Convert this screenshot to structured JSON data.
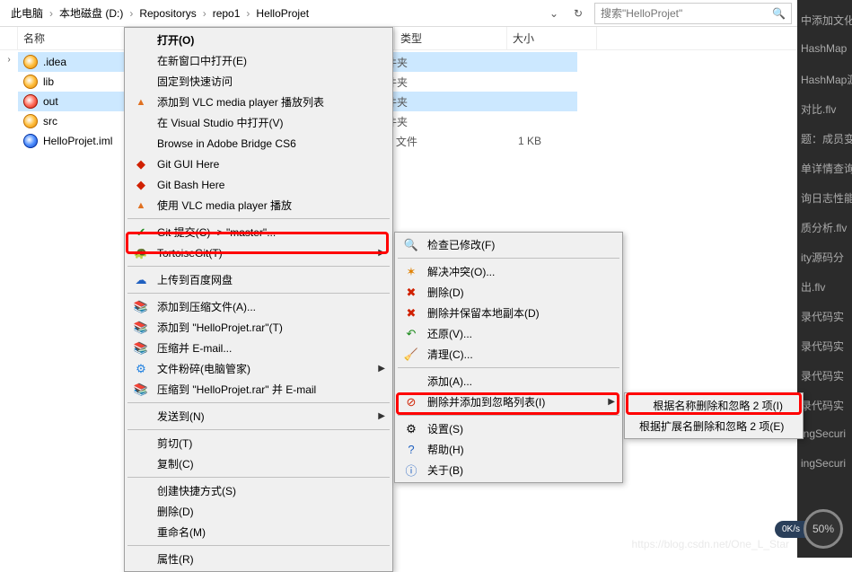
{
  "breadcrumb": {
    "items": [
      "此电脑",
      "本地磁盘 (D:)",
      "Repositorys",
      "repo1",
      "HelloProjet"
    ],
    "refresh": "↻"
  },
  "search": {
    "placeholder": "搜索\"HelloProjet\""
  },
  "columns": {
    "name": "名称",
    "type": "类型",
    "size": "大小"
  },
  "files": [
    {
      "name": ".idea",
      "type": "文件夹",
      "size": "",
      "icon": "y",
      "sel": true
    },
    {
      "name": "lib",
      "type": "文件夹",
      "size": "",
      "icon": "y",
      "sel": false
    },
    {
      "name": "out",
      "type": "文件夹",
      "size": "",
      "icon": "r",
      "sel": true
    },
    {
      "name": "src",
      "type": "文件夹",
      "size": "",
      "icon": "y",
      "sel": false
    },
    {
      "name": "HelloProjet.iml",
      "type": "IML 文件",
      "size": "1 KB",
      "icon": "b",
      "sel": false
    }
  ],
  "ctx1": [
    {
      "t": "打开(O)",
      "icon": "",
      "bold": true
    },
    {
      "t": "在新窗口中打开(E)",
      "icon": ""
    },
    {
      "t": "固定到快速访问",
      "icon": ""
    },
    {
      "t": "添加到 VLC media player 播放列表",
      "icon": "▲",
      "cls": "vlc"
    },
    {
      "t": "在 Visual Studio 中打开(V)",
      "icon": ""
    },
    {
      "t": "Browse in Adobe Bridge CS6",
      "icon": ""
    },
    {
      "t": "Git GUI Here",
      "icon": "◆",
      "cls": "red"
    },
    {
      "t": "Git Bash Here",
      "icon": "◆",
      "cls": "red"
    },
    {
      "t": "使用 VLC media player 播放",
      "icon": "▲",
      "cls": "vlc"
    },
    {
      "sep": true
    },
    {
      "t": "Git 提交(C) -> \"master\"...",
      "icon": "✔",
      "cls": "git-green"
    },
    {
      "t": "TortoiseGit(T)",
      "icon": "🐢",
      "cls": "git-blue",
      "arrow": true
    },
    {
      "sep": true
    },
    {
      "t": "上传到百度网盘",
      "icon": "☁",
      "cls": "blue"
    },
    {
      "sep": true
    },
    {
      "t": "添加到压缩文件(A)...",
      "icon": "📚",
      "cls": "rar"
    },
    {
      "t": "添加到 \"HelloProjet.rar\"(T)",
      "icon": "📚",
      "cls": "rar"
    },
    {
      "t": "压缩并 E-mail...",
      "icon": "📚",
      "cls": "rar"
    },
    {
      "t": "文件粉碎(电脑管家)",
      "icon": "⚙",
      "cls": "qq",
      "arrow": true
    },
    {
      "t": "压缩到 \"HelloProjet.rar\" 并 E-mail",
      "icon": "📚",
      "cls": "rar"
    },
    {
      "sep": true
    },
    {
      "t": "发送到(N)",
      "icon": "",
      "arrow": true
    },
    {
      "sep": true
    },
    {
      "t": "剪切(T)",
      "icon": ""
    },
    {
      "t": "复制(C)",
      "icon": ""
    },
    {
      "sep": true
    },
    {
      "t": "创建快捷方式(S)",
      "icon": ""
    },
    {
      "t": "删除(D)",
      "icon": ""
    },
    {
      "t": "重命名(M)",
      "icon": ""
    },
    {
      "sep": true
    },
    {
      "t": "属性(R)",
      "icon": ""
    }
  ],
  "ctx2": [
    {
      "t": "检查已修改(F)",
      "icon": "🔍",
      "cls": "git-blue"
    },
    {
      "sep": true
    },
    {
      "t": "解决冲突(O)...",
      "icon": "✶",
      "cls": "orange"
    },
    {
      "t": "删除(D)",
      "icon": "✖",
      "cls": "red"
    },
    {
      "t": "删除并保留本地副本(D)",
      "icon": "✖",
      "cls": "red"
    },
    {
      "t": "还原(V)...",
      "icon": "↶",
      "cls": "git-green"
    },
    {
      "t": "清理(C)...",
      "icon": "🧹",
      "cls": "blue"
    },
    {
      "sep": true
    },
    {
      "t": "添加(A)...",
      "icon": "",
      "cls": ""
    },
    {
      "t": "删除并添加到忽略列表(I)",
      "icon": "⊘",
      "cls": "red",
      "arrow": true
    },
    {
      "sep": true
    },
    {
      "t": "设置(S)",
      "icon": "⚙",
      "cls": ""
    },
    {
      "t": "帮助(H)",
      "icon": "?",
      "cls": "blue"
    },
    {
      "t": "关于(B)",
      "icon": "ⓘ",
      "cls": "blue"
    }
  ],
  "ctx3": [
    {
      "t": "根据名称删除和忽略 2 项(I)"
    },
    {
      "t": "根据扩展名删除和忽略 2 项(E)"
    }
  ],
  "darkpanel": [
    "中添加文化",
    "HashMap",
    "HashMap源",
    "对比.flv",
    "题：成员变",
    "单详情查询",
    "询日志性能",
    "质分析.flv",
    "ity源码分",
    "出.flv",
    "录代码实",
    "录代码实",
    "录代码实",
    "录代码实",
    "ingSecuri",
    "ingSecuri"
  ],
  "speed": {
    "rate": "0K/s",
    "pct": "50%"
  },
  "watermark": "https://blog.csdn.net/One_L_Star"
}
